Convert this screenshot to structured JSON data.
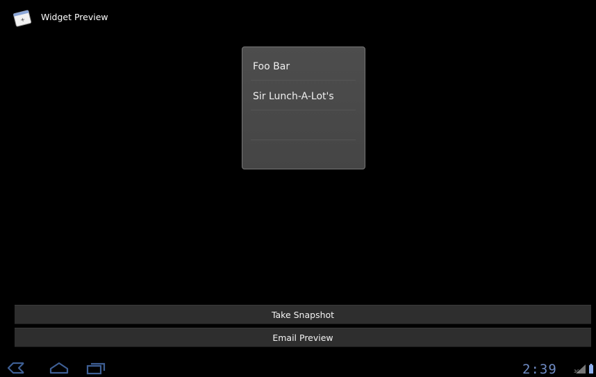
{
  "app": {
    "title": "Widget Preview",
    "icon": "widget-preview-app-icon"
  },
  "widget": {
    "items": [
      {
        "label": "Foo Bar"
      },
      {
        "label": "Sir Lunch-A-Lot's"
      },
      {
        "label": ""
      },
      {
        "label": ""
      }
    ]
  },
  "actions": {
    "take_snapshot_label": "Take Snapshot",
    "email_preview_label": "Email Preview"
  },
  "system_bar": {
    "nav_icons": [
      "back-icon",
      "home-icon",
      "recent-apps-icon"
    ],
    "clock": "2:39",
    "network_label": "3G",
    "status_icons": [
      "network-3g-icon",
      "signal-icon",
      "battery-icon"
    ]
  },
  "colors": {
    "background": "#000000",
    "widget_background": "#4a4a4a",
    "button_background": "#2e2e2e",
    "nav_icon": "#3a5a8a",
    "clock": "#7d96c7"
  }
}
